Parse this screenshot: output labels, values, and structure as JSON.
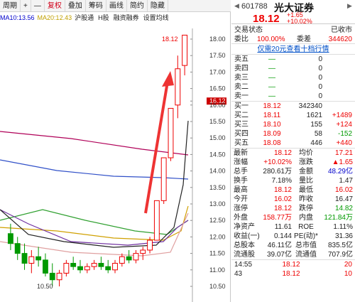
{
  "toolbar": {
    "items": [
      "周期",
      "+",
      "—",
      "复权",
      "叠加",
      "筹码",
      "画线",
      "简约",
      "隐藏"
    ]
  },
  "ma_bar": {
    "ma10": "MA10:13.56",
    "ma20": "MA20:12.43",
    "links": [
      "沪股通",
      "H股",
      "融资融券",
      "设置均线"
    ]
  },
  "price_axis": [
    "18.00",
    "17.50",
    "17.00",
    "16.50",
    "16.12",
    "16.00",
    "15.50",
    "15.00",
    "14.50",
    "14.00",
    "13.50",
    "13.00",
    "12.50",
    "12.00",
    "11.50",
    "11.00",
    "10.50"
  ],
  "chart_labels": {
    "high": "18.12",
    "low": "10.50"
  },
  "chart_data": {
    "type": "candlestick",
    "candles": [
      {
        "o": 12.1,
        "h": 12.4,
        "l": 11.6,
        "c": 11.8
      },
      {
        "o": 11.8,
        "h": 12.0,
        "l": 11.3,
        "c": 11.5
      },
      {
        "o": 11.5,
        "h": 11.8,
        "l": 11.0,
        "c": 11.2
      },
      {
        "o": 11.2,
        "h": 11.6,
        "l": 10.9,
        "c": 11.4
      },
      {
        "o": 11.4,
        "h": 11.7,
        "l": 11.1,
        "c": 11.3
      },
      {
        "o": 11.3,
        "h": 11.5,
        "l": 10.8,
        "c": 10.9
      },
      {
        "o": 10.9,
        "h": 11.2,
        "l": 10.5,
        "c": 10.7
      },
      {
        "o": 10.7,
        "h": 11.0,
        "l": 10.5,
        "c": 10.9
      },
      {
        "o": 10.9,
        "h": 11.3,
        "l": 10.8,
        "c": 11.2
      },
      {
        "o": 11.2,
        "h": 11.4,
        "l": 11.0,
        "c": 11.1
      },
      {
        "o": 11.1,
        "h": 11.3,
        "l": 10.9,
        "c": 11.0
      },
      {
        "o": 11.0,
        "h": 11.2,
        "l": 10.9,
        "c": 11.1
      },
      {
        "o": 11.1,
        "h": 11.3,
        "l": 11.0,
        "c": 11.2
      },
      {
        "o": 11.2,
        "h": 11.4,
        "l": 11.0,
        "c": 11.1
      },
      {
        "o": 11.1,
        "h": 11.3,
        "l": 10.9,
        "c": 11.0
      },
      {
        "o": 11.0,
        "h": 11.3,
        "l": 10.9,
        "c": 11.2
      },
      {
        "o": 11.2,
        "h": 11.5,
        "l": 11.1,
        "c": 11.4
      },
      {
        "o": 11.4,
        "h": 11.6,
        "l": 11.2,
        "c": 11.3
      },
      {
        "o": 11.3,
        "h": 11.6,
        "l": 11.2,
        "c": 11.5
      },
      {
        "o": 11.5,
        "h": 11.7,
        "l": 11.3,
        "c": 11.6
      },
      {
        "o": 11.6,
        "h": 12.0,
        "l": 11.5,
        "c": 11.9
      },
      {
        "o": 11.9,
        "h": 13.1,
        "l": 11.9,
        "c": 13.1
      },
      {
        "o": 13.1,
        "h": 14.4,
        "l": 13.0,
        "c": 14.4
      },
      {
        "o": 14.4,
        "h": 15.9,
        "l": 14.3,
        "c": 15.9
      },
      {
        "o": 16.0,
        "h": 17.5,
        "l": 15.6,
        "c": 17.1
      },
      {
        "o": 17.2,
        "h": 18.12,
        "l": 16.9,
        "c": 18.12
      }
    ]
  },
  "stock": {
    "code": "601788",
    "name": "光大证券",
    "price": "18.12",
    "change": "+1.65",
    "pct": "+10.02%"
  },
  "status": {
    "label": "交易状态",
    "value": "已收市"
  },
  "ratio": {
    "l1": "委比",
    "v1": "100.00%",
    "l2": "委差",
    "v2": "344620"
  },
  "promo": "仅需20元查看十档行情",
  "sell": [
    {
      "n": "卖五",
      "p": "—",
      "v": "0"
    },
    {
      "n": "卖四",
      "p": "—",
      "v": "0"
    },
    {
      "n": "卖三",
      "p": "—",
      "v": "0"
    },
    {
      "n": "卖二",
      "p": "—",
      "v": "0"
    },
    {
      "n": "卖一",
      "p": "—",
      "v": "0"
    }
  ],
  "buy": [
    {
      "n": "买一",
      "p": "18.12",
      "v": "342340",
      "d": ""
    },
    {
      "n": "买二",
      "p": "18.11",
      "v": "1621",
      "d": "+1489"
    },
    {
      "n": "买三",
      "p": "18.10",
      "v": "155",
      "d": "+124"
    },
    {
      "n": "买四",
      "p": "18.09",
      "v": "58",
      "d": "-152"
    },
    {
      "n": "买五",
      "p": "18.08",
      "v": "446",
      "d": "+440"
    }
  ],
  "stats": [
    [
      "最新",
      "18.12",
      "均价",
      "17.21"
    ],
    [
      "涨幅",
      "+10.02%",
      "涨跌",
      "▲1.65"
    ],
    [
      "总手",
      "280.61万",
      "金额",
      "48.29亿"
    ],
    [
      "换手",
      "7.18%",
      "量比",
      "1.47"
    ],
    [
      "最高",
      "18.12",
      "最低",
      "16.02"
    ],
    [
      "今开",
      "16.02",
      "昨收",
      "16.47"
    ],
    [
      "涨停",
      "18.12",
      "跌停",
      "14.82"
    ],
    [
      "外盘",
      "158.77万",
      "内盘",
      "121.84万"
    ],
    [
      "净资产",
      "11.61",
      "ROE",
      "1.11%"
    ],
    [
      "收益(一)",
      "0.144",
      "PE(动)*",
      "31.36"
    ],
    [
      "总股本",
      "46.11亿",
      "总市值",
      "835.5亿"
    ],
    [
      "流通股",
      "39.07亿",
      "流通值",
      "707.9亿"
    ]
  ],
  "ticks": [
    {
      "t": "14:55",
      "p": "18.12",
      "v": "20"
    },
    {
      "t": "43",
      "p": "18.12",
      "v": "10"
    }
  ]
}
